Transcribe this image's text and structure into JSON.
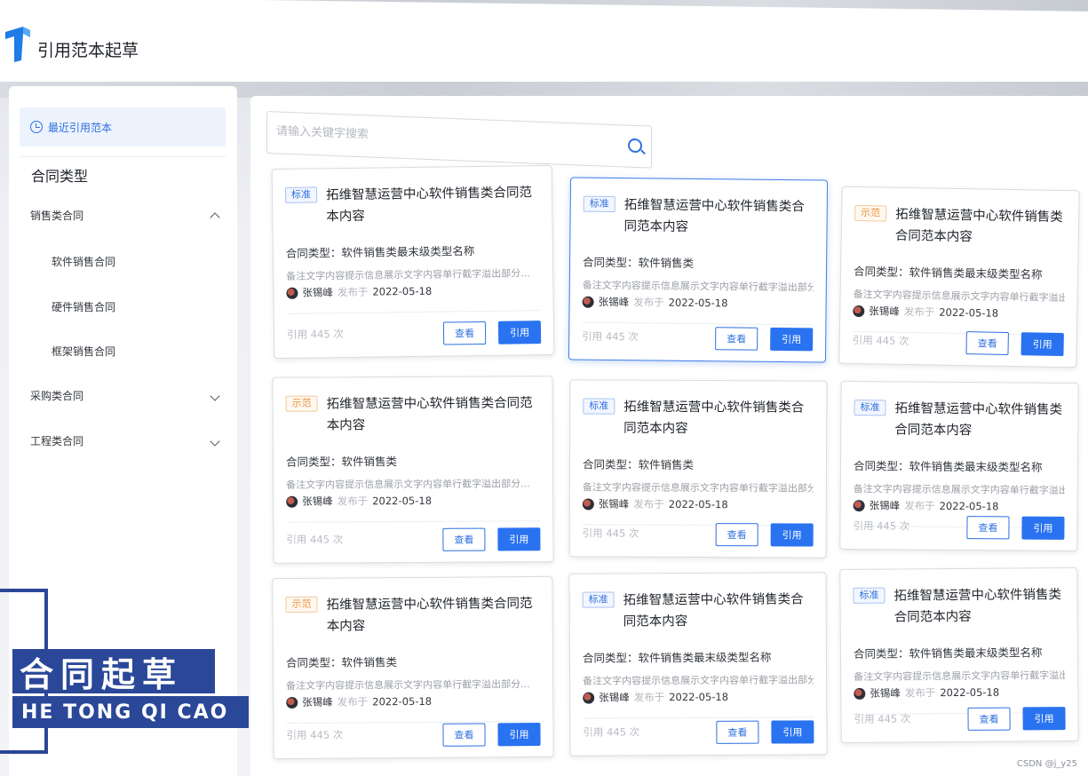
{
  "app": {
    "title": "引用范本起草"
  },
  "sidebar": {
    "recent_label": "最近引用范本",
    "section_title": "合同类型",
    "groups": [
      {
        "label": "销售类合同",
        "expanded": true,
        "children": [
          "软件销售合同",
          "硬件销售合同",
          "框架销售合同"
        ]
      },
      {
        "label": "采购类合同",
        "expanded": false
      },
      {
        "label": "工程类合同",
        "expanded": false
      }
    ]
  },
  "search": {
    "placeholder": "请输入关键字搜索",
    "value": ""
  },
  "card_labels": {
    "view": "查看",
    "use": "引用",
    "published_word": "发布于"
  },
  "cards": [
    {
      "tag": "标准",
      "tag_type": "std",
      "title": "拓维智慧运营中心软件销售类合同范本内容",
      "contract_type": "合同类型：软件销售类最末级类型名称",
      "note": "备注文字内容提示信息展示文字内容单行截字溢出部分...",
      "author": "张锡峰",
      "date": "2022-05-18",
      "count": "引用 445 次"
    },
    {
      "tag": "标准",
      "tag_type": "std",
      "title": "拓维智慧运营中心软件销售类合同范本内容",
      "contract_type": "合同类型：软件销售类",
      "note": "备注文字内容提示信息展示文字内容单行截字溢出部分...",
      "author": "张锡峰",
      "date": "2022-05-18",
      "count": "引用 445 次",
      "active": true
    },
    {
      "tag": "示范",
      "tag_type": "demo",
      "title": "拓维智慧运营中心软件销售类合同范本内容",
      "contract_type": "合同类型：软件销售类最末级类型名称",
      "note": "备注文字内容提示信息展示文字内容单行截字溢出部分...",
      "author": "张锡峰",
      "date": "2022-05-18",
      "count": "引用 445 次"
    },
    {
      "tag": "示范",
      "tag_type": "demo",
      "title": "拓维智慧运营中心软件销售类合同范本内容",
      "contract_type": "合同类型：软件销售类",
      "note": "备注文字内容提示信息展示文字内容单行截字溢出部分...",
      "author": "张锡峰",
      "date": "2022-05-18",
      "count": "引用 445 次"
    },
    {
      "tag": "标准",
      "tag_type": "std",
      "title": "拓维智慧运营中心软件销售类合同范本内容",
      "contract_type": "合同类型：软件销售类",
      "note": "备注文字内容提示信息展示文字内容单行截字溢出部分...",
      "author": "张锡峰",
      "date": "2022-05-18",
      "count": "引用 445 次"
    },
    {
      "tag": "标准",
      "tag_type": "std",
      "title": "拓维智慧运营中心软件销售类合同范本内容",
      "contract_type": "合同类型：软件销售类最末级类型名称",
      "note": "备注文字内容提示信息展示文字内容单行截字溢出部分...",
      "author": "张锡峰",
      "date": "2022-05-18",
      "count": "引用 445 次"
    },
    {
      "tag": "示范",
      "tag_type": "demo",
      "title": "拓维智慧运营中心软件销售类合同范本内容",
      "contract_type": "合同类型：软件销售类",
      "note": "备注文字内容提示信息展示文字内容单行截字溢出部分...",
      "author": "张锡峰",
      "date": "2022-05-18",
      "count": "引用 445 次"
    },
    {
      "tag": "标准",
      "tag_type": "std",
      "title": "拓维智慧运营中心软件销售类合同范本内容",
      "contract_type": "合同类型：软件销售类最末级类型名称",
      "note": "备注文字内容提示信息展示文字内容单行截字溢出部分...",
      "author": "张锡峰",
      "date": "2022-05-18",
      "count": "引用 445 次"
    },
    {
      "tag": "标准",
      "tag_type": "std",
      "title": "拓维智慧运营中心软件销售类合同范本内容",
      "contract_type": "合同类型：软件销售类最末级类型名称",
      "note": "备注文字内容提示信息展示文字内容单行截字溢出部分...",
      "author": "张锡峰",
      "date": "2022-05-18",
      "count": "引用 445 次"
    }
  ],
  "watermark": {
    "cn": "合同起草",
    "en": "HE TONG QI CAO"
  },
  "credit": "CSDN @j_y25",
  "colors": {
    "accent": "#2e6fe0",
    "std_tag": "#2e6fe0",
    "demo_tag": "#e8913a",
    "watermark": "#2a4798"
  }
}
